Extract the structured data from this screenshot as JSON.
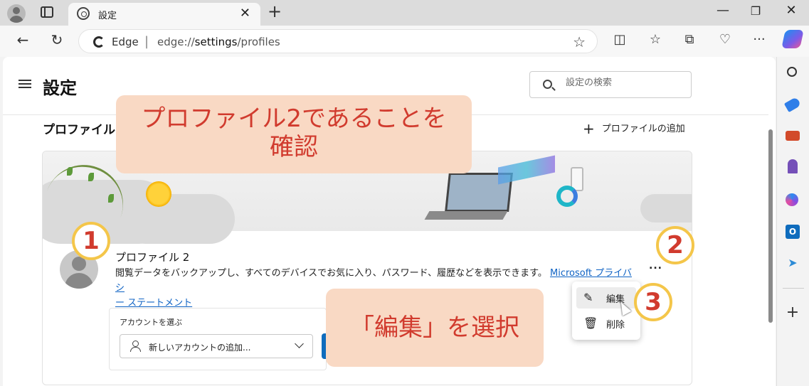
{
  "browser": {
    "tab_title": "設定",
    "brand": "Edge",
    "url_prefix": "edge://",
    "url_bold": "settings",
    "url_suffix": "/profiles",
    "window_controls": [
      "minimize",
      "restore",
      "close"
    ]
  },
  "settings": {
    "title": "設定",
    "search_placeholder": "設定の検索",
    "section_title": "プロファイル",
    "add_profile": "プロファイルの追加",
    "profile": {
      "name": "プロファイル 2",
      "description": "閲覧データをバックアップし、すべてのデバイスでお気に入り、パスワード、履歴などを表示できます。",
      "link_text_1": "Microsoft プライバシ",
      "link_text_2": "ー ステートメント",
      "more": "..."
    },
    "account": {
      "label": "アカウントを選ぶ",
      "select_value": "新しいアカウントの追加..."
    },
    "menu": {
      "edit": "編集",
      "delete": "削除"
    }
  },
  "annotations": {
    "callout_1_line_1": "プロファイル2であることを",
    "callout_1_line_2": "確認",
    "callout_2": "「編集」を選択",
    "badge_1": "1",
    "badge_2": "2",
    "badge_3": "3"
  },
  "colors": {
    "accent": "#0f6cbd",
    "callout_bg": "#f9d9c4",
    "callout_text": "#d13b2e",
    "badge_border": "#f4c64a"
  }
}
